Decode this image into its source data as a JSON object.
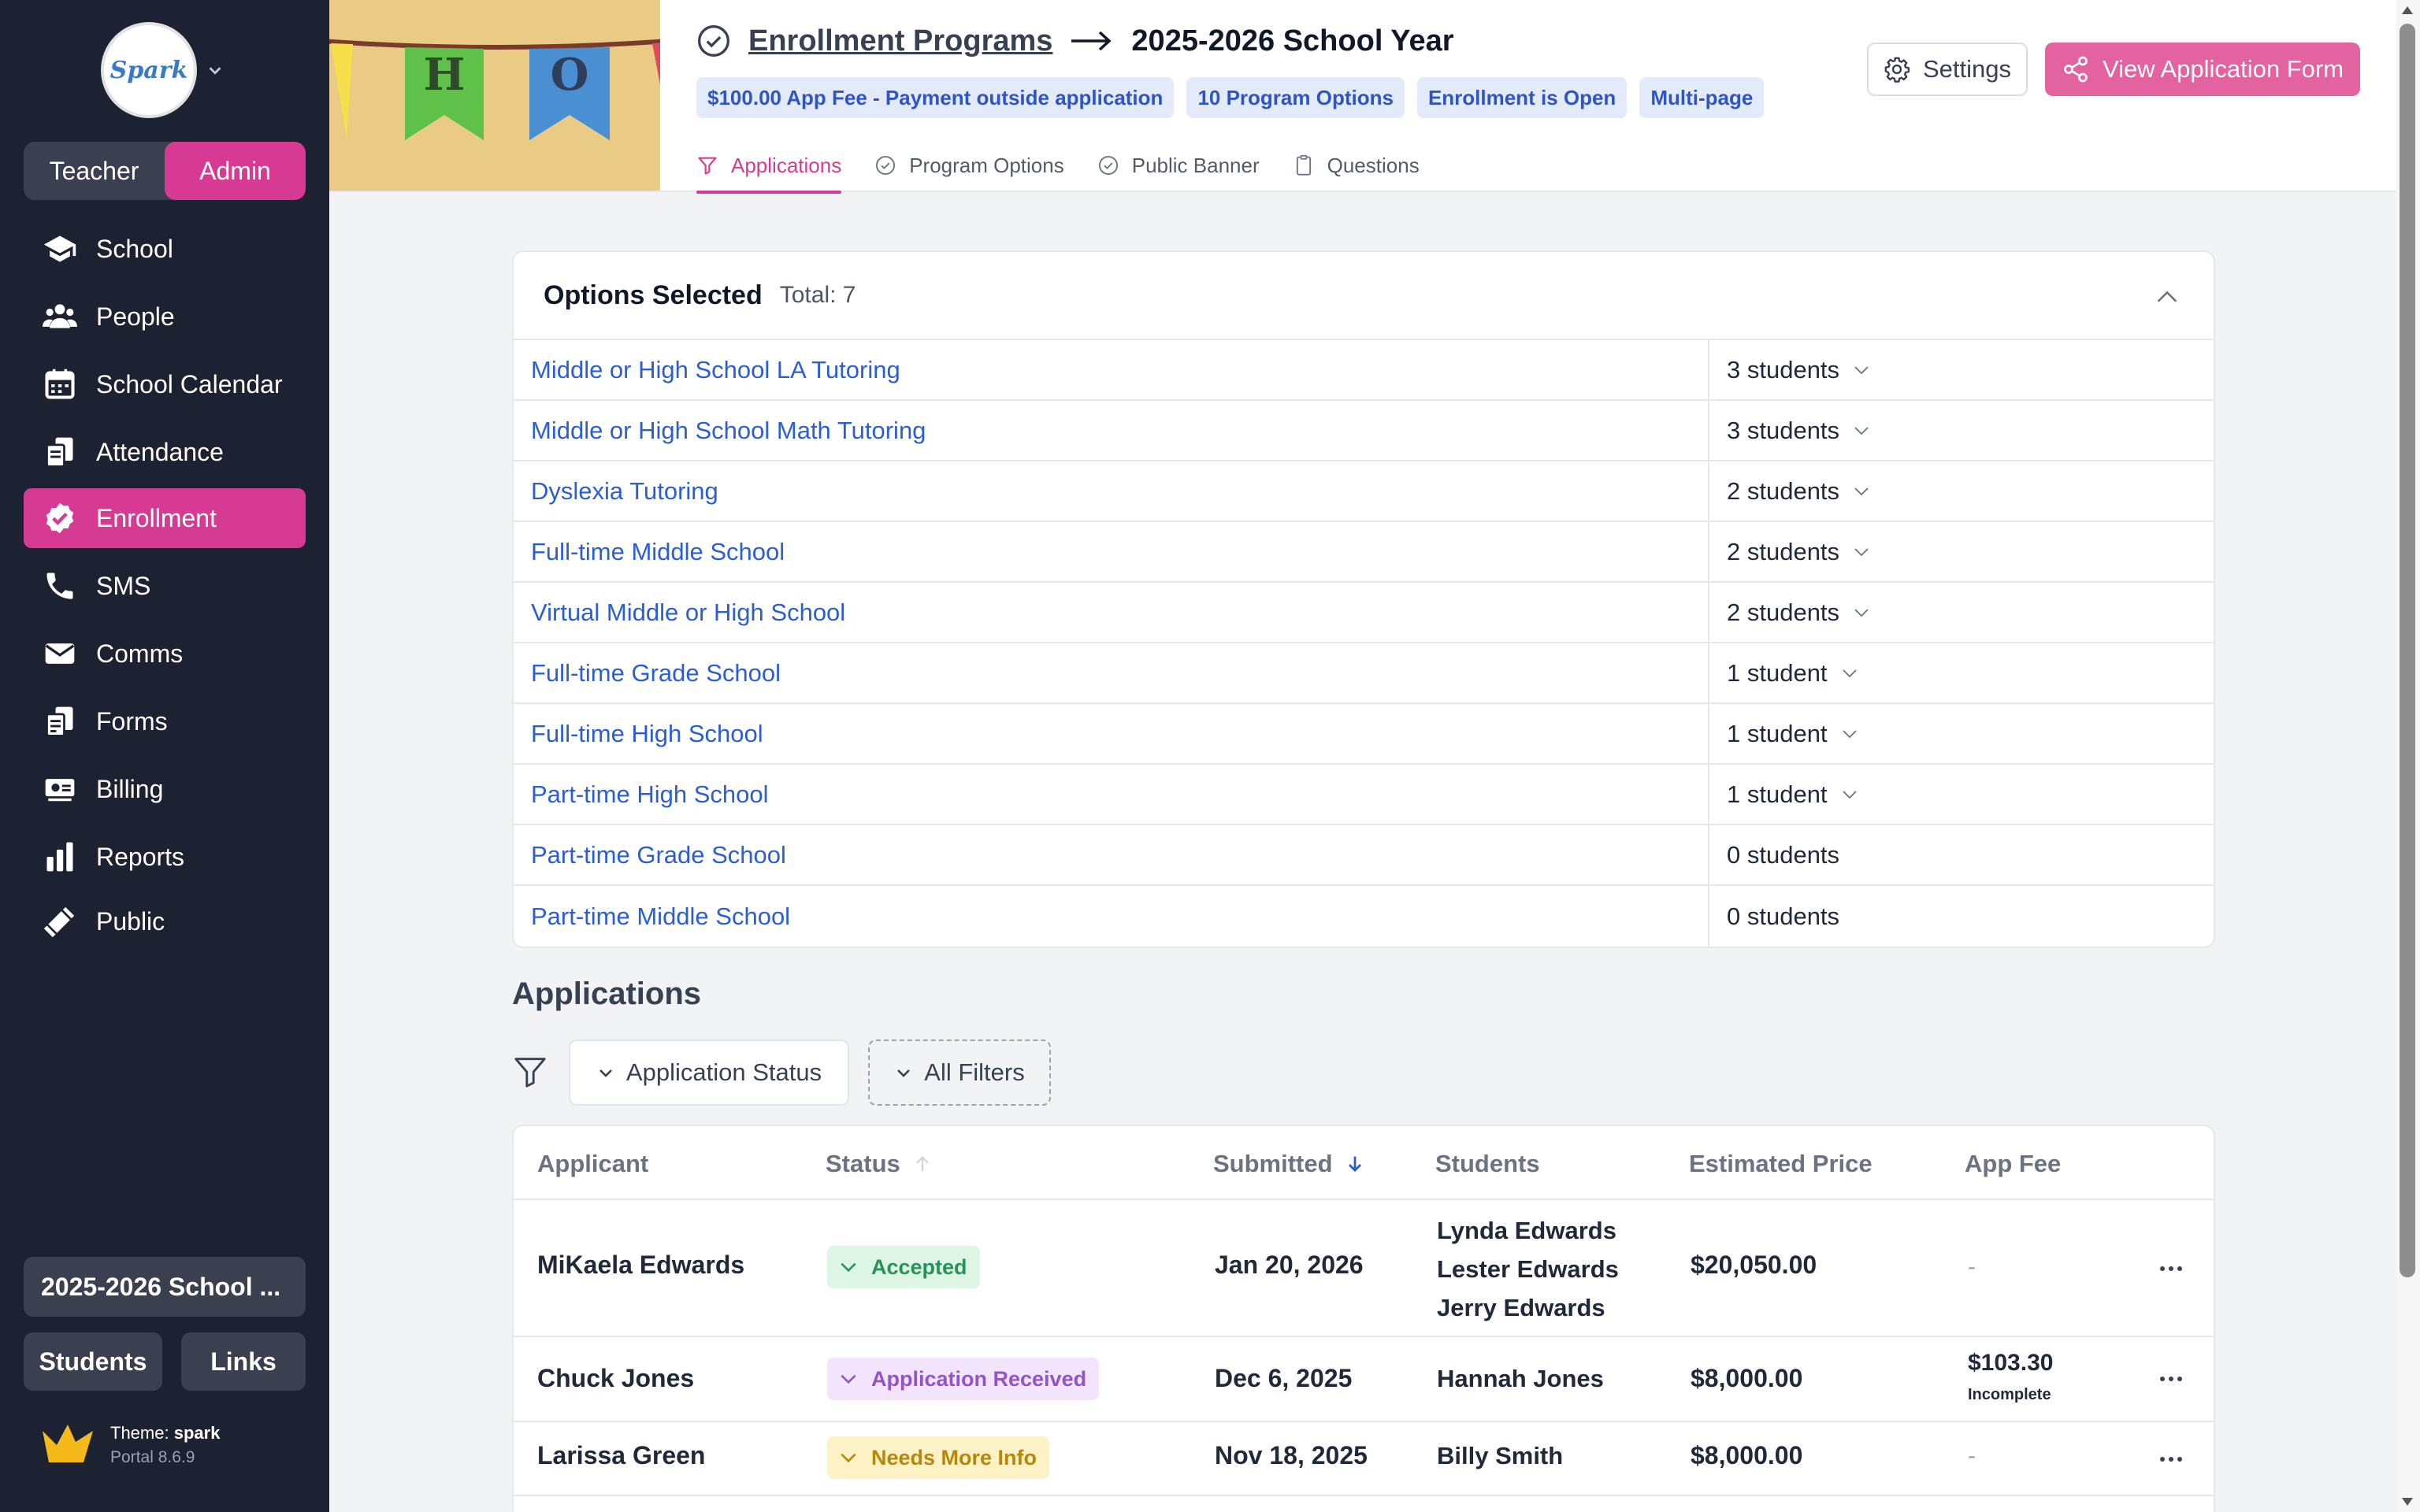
{
  "sidebar": {
    "logo_text": "Spark",
    "roles": [
      "Teacher",
      "Admin"
    ],
    "active_role": "Admin",
    "nav": [
      {
        "label": "School",
        "icon": "graduation-cap-icon"
      },
      {
        "label": "People",
        "icon": "people-icon"
      },
      {
        "label": "School Calendar",
        "icon": "calendar-icon"
      },
      {
        "label": "Attendance",
        "icon": "clipboard-icon"
      },
      {
        "label": "Enrollment",
        "icon": "check-badge-icon"
      },
      {
        "label": "SMS",
        "icon": "phone-icon"
      },
      {
        "label": "Comms",
        "icon": "envelope-icon"
      },
      {
        "label": "Forms",
        "icon": "forms-icon"
      },
      {
        "label": "Billing",
        "icon": "money-icon"
      },
      {
        "label": "Reports",
        "icon": "bar-chart-icon"
      },
      {
        "label": "Public",
        "icon": "bullhorn-icon"
      }
    ],
    "active_nav": "Enrollment",
    "year_button": "2025-2026 School ...",
    "students_button": "Students",
    "links_button": "Links",
    "theme_label": "Theme:",
    "theme_name": "spark",
    "portal_version": "Portal 8.6.9"
  },
  "header": {
    "breadcrumb_link": "Enrollment Programs",
    "breadcrumb_current": "2025-2026 School Year",
    "badges": [
      "$100.00 App Fee - Payment outside application",
      "10 Program Options",
      "Enrollment is Open",
      "Multi-page"
    ],
    "tabs": [
      "Applications",
      "Program Options",
      "Public Banner",
      "Questions"
    ],
    "active_tab": "Applications",
    "settings_label": "Settings",
    "view_form_label": "View Application Form",
    "banner_letters": [
      "H",
      "O"
    ]
  },
  "options": {
    "title": "Options Selected",
    "total": "Total: 7",
    "rows": [
      {
        "name": "Middle or High School LA Tutoring",
        "count": "3 students",
        "expandable": true
      },
      {
        "name": "Middle or High School Math Tutoring",
        "count": "3 students",
        "expandable": true
      },
      {
        "name": "Dyslexia Tutoring",
        "count": "2 students",
        "expandable": true
      },
      {
        "name": "Full-time Middle School",
        "count": "2 students",
        "expandable": true
      },
      {
        "name": "Virtual Middle or High School",
        "count": "2 students",
        "expandable": true
      },
      {
        "name": "Full-time Grade School",
        "count": "1 student",
        "expandable": true
      },
      {
        "name": "Full-time High School",
        "count": "1 student",
        "expandable": true
      },
      {
        "name": "Part-time High School",
        "count": "1 student",
        "expandable": true
      },
      {
        "name": "Part-time Grade School",
        "count": "0 students",
        "expandable": false
      },
      {
        "name": "Part-time Middle School",
        "count": "0 students",
        "expandable": false
      }
    ]
  },
  "applications": {
    "title": "Applications",
    "status_filter": "Application Status",
    "all_filters": "All Filters",
    "columns": [
      "Applicant",
      "Status",
      "Submitted",
      "Students",
      "Estimated Price",
      "App Fee"
    ],
    "rows": [
      {
        "applicant": "MiKaela Edwards",
        "status": "Accepted",
        "submitted": "Jan 20, 2026",
        "students": [
          "Lynda Edwards",
          "Lester Edwards",
          "Jerry Edwards"
        ],
        "price": "$20,050.00",
        "fee": "-",
        "fee_note": ""
      },
      {
        "applicant": "Chuck Jones",
        "status": "Application Received",
        "submitted": "Dec 6, 2025",
        "students": [
          "Hannah Jones"
        ],
        "price": "$8,000.00",
        "fee": "$103.30",
        "fee_note": "Incomplete"
      },
      {
        "applicant": "Larissa Green",
        "status": "Needs More Info",
        "submitted": "Nov 18, 2025",
        "students": [
          "Billy Smith"
        ],
        "price": "$8,000.00",
        "fee": "-",
        "fee_note": ""
      }
    ]
  },
  "colors": {
    "accent": "#d63a93",
    "sidebar_bg": "#1d2233",
    "link": "#2b5ed3",
    "badge_bg": "#e3ebfb",
    "badge_text": "#2f55c4"
  }
}
